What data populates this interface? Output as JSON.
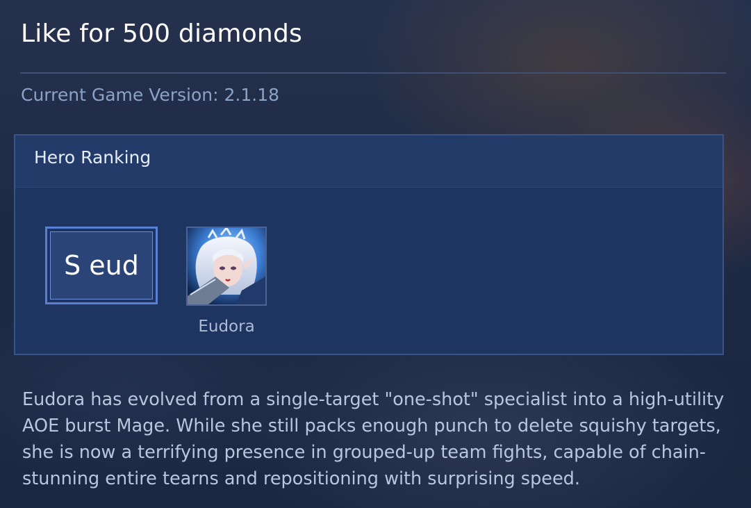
{
  "header": {
    "title": "Like for 500 diamonds",
    "version_text": "Current Game Version: 2.1.18"
  },
  "hero_ranking": {
    "title": "Hero Ranking",
    "tier_label": "S eud",
    "heroes": [
      {
        "name": "Eudora",
        "portrait_icon": "hero-portrait-eudora"
      }
    ]
  },
  "description": "Eudora has evolved from a single-target \"one-shot\" specialist into a high-utility AOE burst Mage. While she still packs enough punch to delete squishy targets, she is now a terrifying presence in grouped-up team fights, capable of chain-stunning entire tearns and repositioning with surprising speed.",
  "colors": {
    "background": "#1d2a45",
    "panel": "#1f3561",
    "panel_border": "#3b5487",
    "tier_border": "#5b7fd0",
    "version_text": "#8aa3c6"
  }
}
